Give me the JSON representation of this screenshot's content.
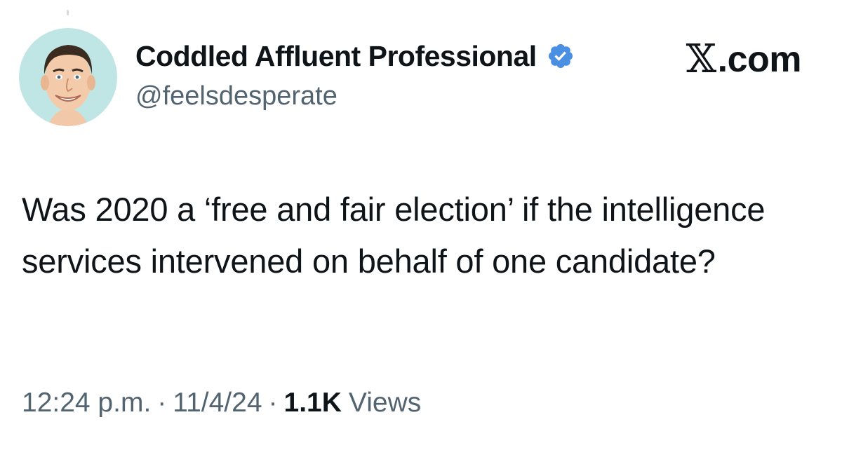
{
  "author": {
    "display_name": "Coddled Affluent Professional",
    "handle": "@feelsdesperate",
    "verified": true,
    "verified_color": "#4a90e2"
  },
  "site": {
    "logo_glyph": "𝕏",
    "label": ".com"
  },
  "tweet": {
    "text": "Was 2020 a ‘free and fair election’ if the intelligence services intervened on behalf of one candidate?"
  },
  "meta": {
    "time": "12:24 p.m.",
    "separator": "·",
    "date": "11/4/24",
    "views_count": "1.1K",
    "views_label": "Views"
  },
  "colors": {
    "text_primary": "#0f1419",
    "text_secondary": "#536471",
    "avatar_bg": "#bfe6e4"
  }
}
